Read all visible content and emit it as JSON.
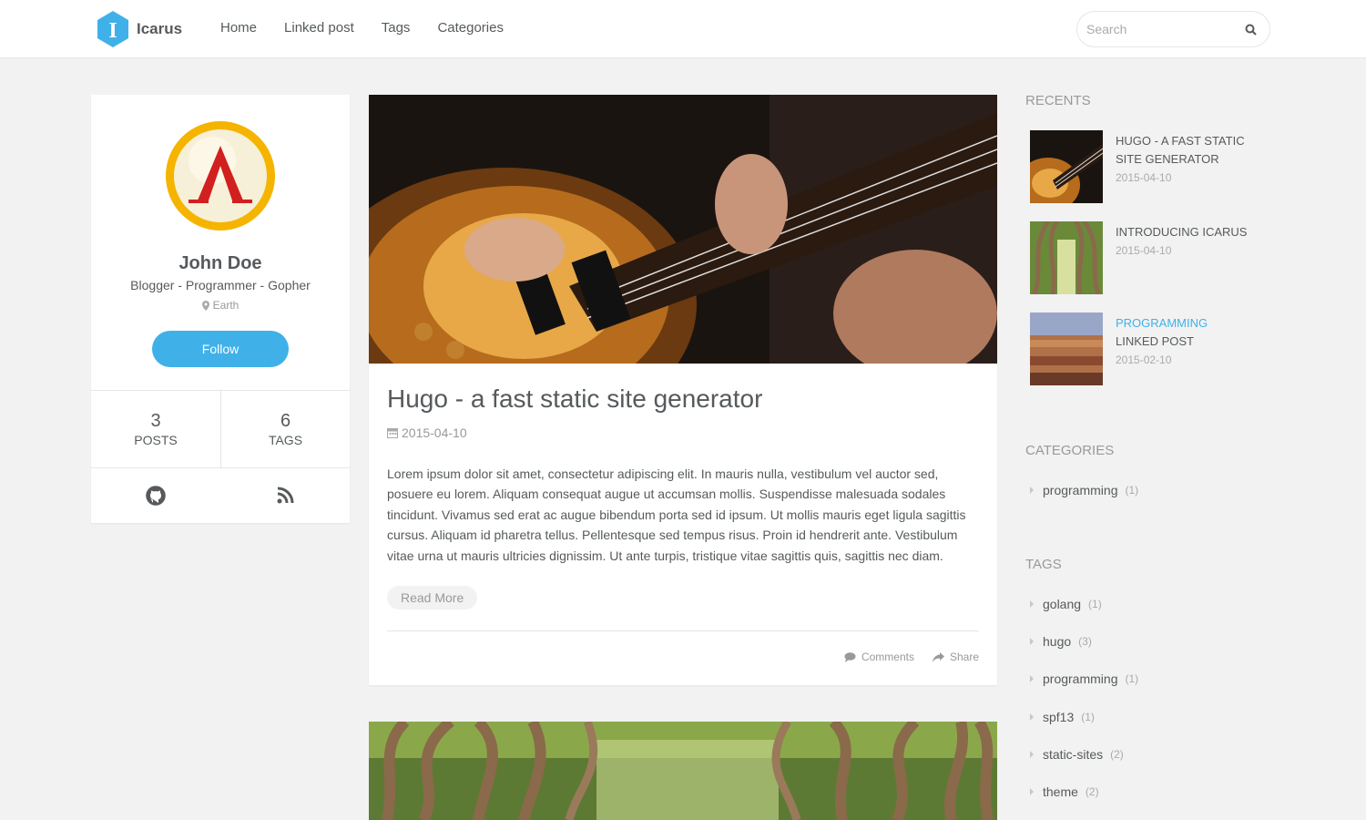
{
  "header": {
    "logo_letter": "I",
    "site_name": "Icarus",
    "nav": [
      "Home",
      "Linked post",
      "Tags",
      "Categories"
    ],
    "search_placeholder": "Search"
  },
  "profile": {
    "name": "John Doe",
    "title": "Blogger - Programmer - Gopher",
    "location": "Earth",
    "follow_label": "Follow",
    "posts_count": "3",
    "posts_label": "Posts",
    "tags_count": "6",
    "tags_label": "Tags"
  },
  "article": {
    "title": "Hugo - a fast static site generator",
    "date": "2015-04-10",
    "body": "Lorem ipsum dolor sit amet, consectetur adipiscing elit. In mauris nulla, vestibulum vel auctor sed, posuere eu lorem. Aliquam consequat augue ut accumsan mollis. Suspendisse malesuada sodales tincidunt. Vivamus sed erat ac augue bibendum porta sed id ipsum. Ut mollis mauris eget ligula sagittis cursus. Aliquam id pharetra tellus. Pellentesque sed tempus risus. Proin id hendrerit ante. Vestibulum vitae urna ut mauris ultricies dignissim. Ut ante turpis, tristique vitae sagittis quis, sagittis nec diam.",
    "read_more": "Read More",
    "comments": "Comments",
    "share": "Share"
  },
  "sidebar": {
    "recents_heading": "Recents",
    "recents": [
      {
        "category": "",
        "title": "Hugo - a fast static site generator",
        "date": "2015-04-10"
      },
      {
        "category": "",
        "title": "Introducing Icarus",
        "date": "2015-04-10"
      },
      {
        "category": "Programming",
        "title": "Linked post",
        "date": "2015-02-10"
      }
    ],
    "categories_heading": "Categories",
    "categories": [
      {
        "name": "programming",
        "count": "(1)"
      }
    ],
    "tags_heading": "Tags",
    "tags": [
      {
        "name": "golang",
        "count": "(1)"
      },
      {
        "name": "hugo",
        "count": "(3)"
      },
      {
        "name": "programming",
        "count": "(1)"
      },
      {
        "name": "spf13",
        "count": "(1)"
      },
      {
        "name": "static-sites",
        "count": "(2)"
      },
      {
        "name": "theme",
        "count": "(2)"
      }
    ]
  },
  "colors": {
    "accent": "#3fb1e8",
    "text": "#565a5c",
    "muted": "#999999",
    "background": "#f2f2f2"
  }
}
